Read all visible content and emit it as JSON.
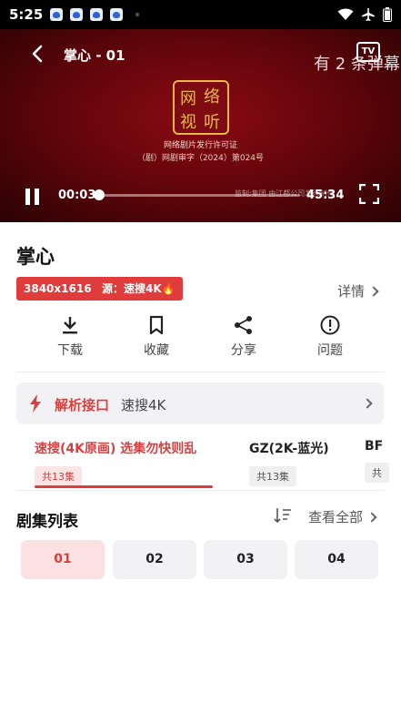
{
  "status": {
    "time": "5:25"
  },
  "player": {
    "title": "掌心 - 01",
    "danmaku": "有 2 条弹幕",
    "cast_label": "TV",
    "license_line1": "网络剧片发行许可证",
    "license_line2": "（剧）网剧审字（2024）第024号",
    "subtitle": "监制:集团  由江都公司发行制作",
    "current_time": "00:03",
    "total_time": "45:34",
    "progress": 0.001,
    "seal_chars": [
      "网",
      "络",
      "视",
      "听"
    ]
  },
  "show": {
    "title": "掌心",
    "badges": [
      "3840x1616",
      "源：速搜4K🔥"
    ],
    "details_label": "详情"
  },
  "actions": [
    "下载",
    "收藏",
    "分享",
    "问题"
  ],
  "parse": {
    "label": "解析接口",
    "value": "速搜4K"
  },
  "sources": [
    {
      "name": "速搜(4K原画) 选集勿快则乱",
      "count": "共13集",
      "active": true
    },
    {
      "name": "GZ(2K-蓝光)",
      "count": "共13集",
      "active": false
    },
    {
      "name": "BF",
      "count": "共",
      "active": false
    }
  ],
  "episodes": {
    "title": "剧集列表",
    "view_all": "查看全部",
    "items": [
      "01",
      "02",
      "03",
      "04"
    ],
    "selected": "01"
  },
  "colors": {
    "accent": "#e03c3c",
    "video_bg": "#5c0509",
    "seal_gold": "#e7b74a"
  }
}
